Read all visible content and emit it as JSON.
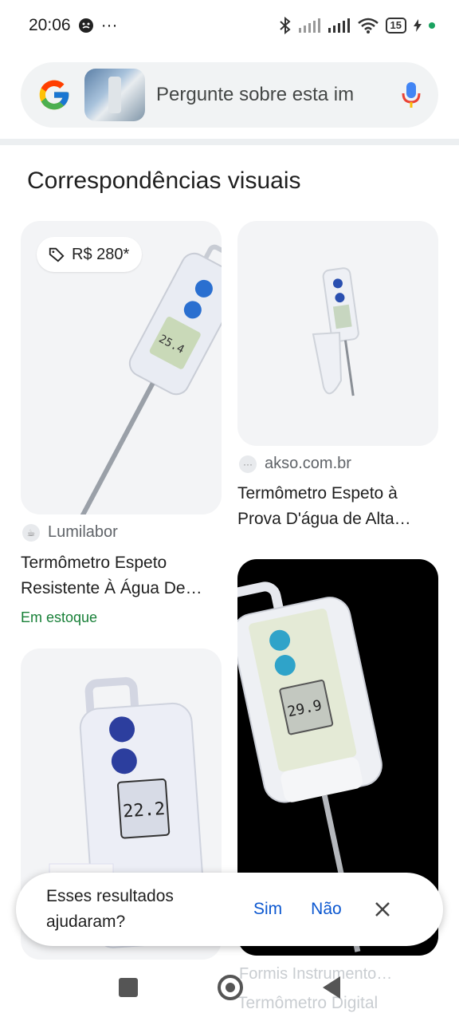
{
  "status_bar": {
    "time": "20:06",
    "more": "···",
    "battery": "15"
  },
  "search": {
    "placeholder": "Pergunte sobre esta im"
  },
  "section": {
    "title": "Correspondências visuais"
  },
  "results": [
    {
      "price": "R$ 280*",
      "source": "Lumilabor",
      "title_line1": "Termômetro Espeto",
      "title_line2": "Resistente À Água De…",
      "stock": "Em estoque"
    },
    {
      "source": "akso.com.br",
      "title_line1": "Termômetro Espeto à",
      "title_line2": "Prova D'água de Alta…"
    },
    {
      "source": "Formis Instrumento…",
      "title_line1": "Termômetro Digital"
    }
  ],
  "display_readings": [
    "25.4",
    "22.2",
    "29.9"
  ],
  "snackbar": {
    "question": "Esses resultados ajudaram?",
    "yes": "Sim",
    "no": "Não"
  },
  "colors": {
    "accent_blue": "#0b57d0",
    "stock_green": "#188038",
    "thermo_blue": "#2a4fb0"
  }
}
